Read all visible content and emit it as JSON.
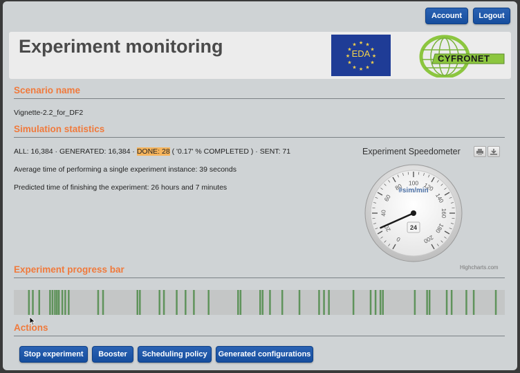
{
  "header": {
    "account_label": "Account",
    "logout_label": "Logout",
    "title": "Experiment monitoring",
    "eda_logo_text": "EDA",
    "cyfronet_logo_text": "CYFRONET"
  },
  "scenario": {
    "heading": "Scenario name",
    "name": "Vignette-2.2_for_DF2"
  },
  "statistics": {
    "heading": "Simulation statistics",
    "summary_prefix": "ALL: 16,384 · GENERATED: 16,384 · ",
    "done_text": "DONE: 28",
    "summary_suffix": " ( '0.17' % COMPLETED ) · SENT: 71",
    "avg_time": "Average time of performing a single experiment instance: 39 seconds",
    "predicted_time": "Predicted time of finishing the experiment: 26 hours and 7 minutes"
  },
  "speedometer": {
    "title": "Experiment Speedometer",
    "unit": "#sim/min",
    "value": 24,
    "value_label": "24",
    "min": 0,
    "max": 200,
    "tick_labels": [
      "0",
      "20",
      "40",
      "60",
      "80",
      "100",
      "120",
      "140",
      "160",
      "180",
      "200"
    ],
    "credit": "Highcharts.com",
    "print_icon": "printer-icon",
    "export_icon": "download-icon"
  },
  "progress": {
    "heading": "Experiment progress bar",
    "total": 16384,
    "done_positions": [
      0.029,
      0.037,
      0.05,
      0.072,
      0.077,
      0.082,
      0.086,
      0.09,
      0.097,
      0.103,
      0.11,
      0.17,
      0.18,
      0.25,
      0.255,
      0.295,
      0.304,
      0.33,
      0.348,
      0.365,
      0.395,
      0.455,
      0.46,
      0.5,
      0.505,
      0.52,
      0.545,
      0.58,
      0.62,
      0.63,
      0.64,
      0.69,
      0.725,
      0.735,
      0.745,
      0.75,
      0.815,
      0.84,
      0.845,
      0.88,
      0.89,
      0.92,
      0.935,
      0.98
    ],
    "done_color": "#4e8a48",
    "empty_color": "#c4c6c6"
  },
  "actions": {
    "heading": "Actions",
    "stop_label": "Stop experiment",
    "booster_label": "Booster",
    "scheduling_label": "Scheduling policy",
    "configs_label": "Generated configurations"
  }
}
